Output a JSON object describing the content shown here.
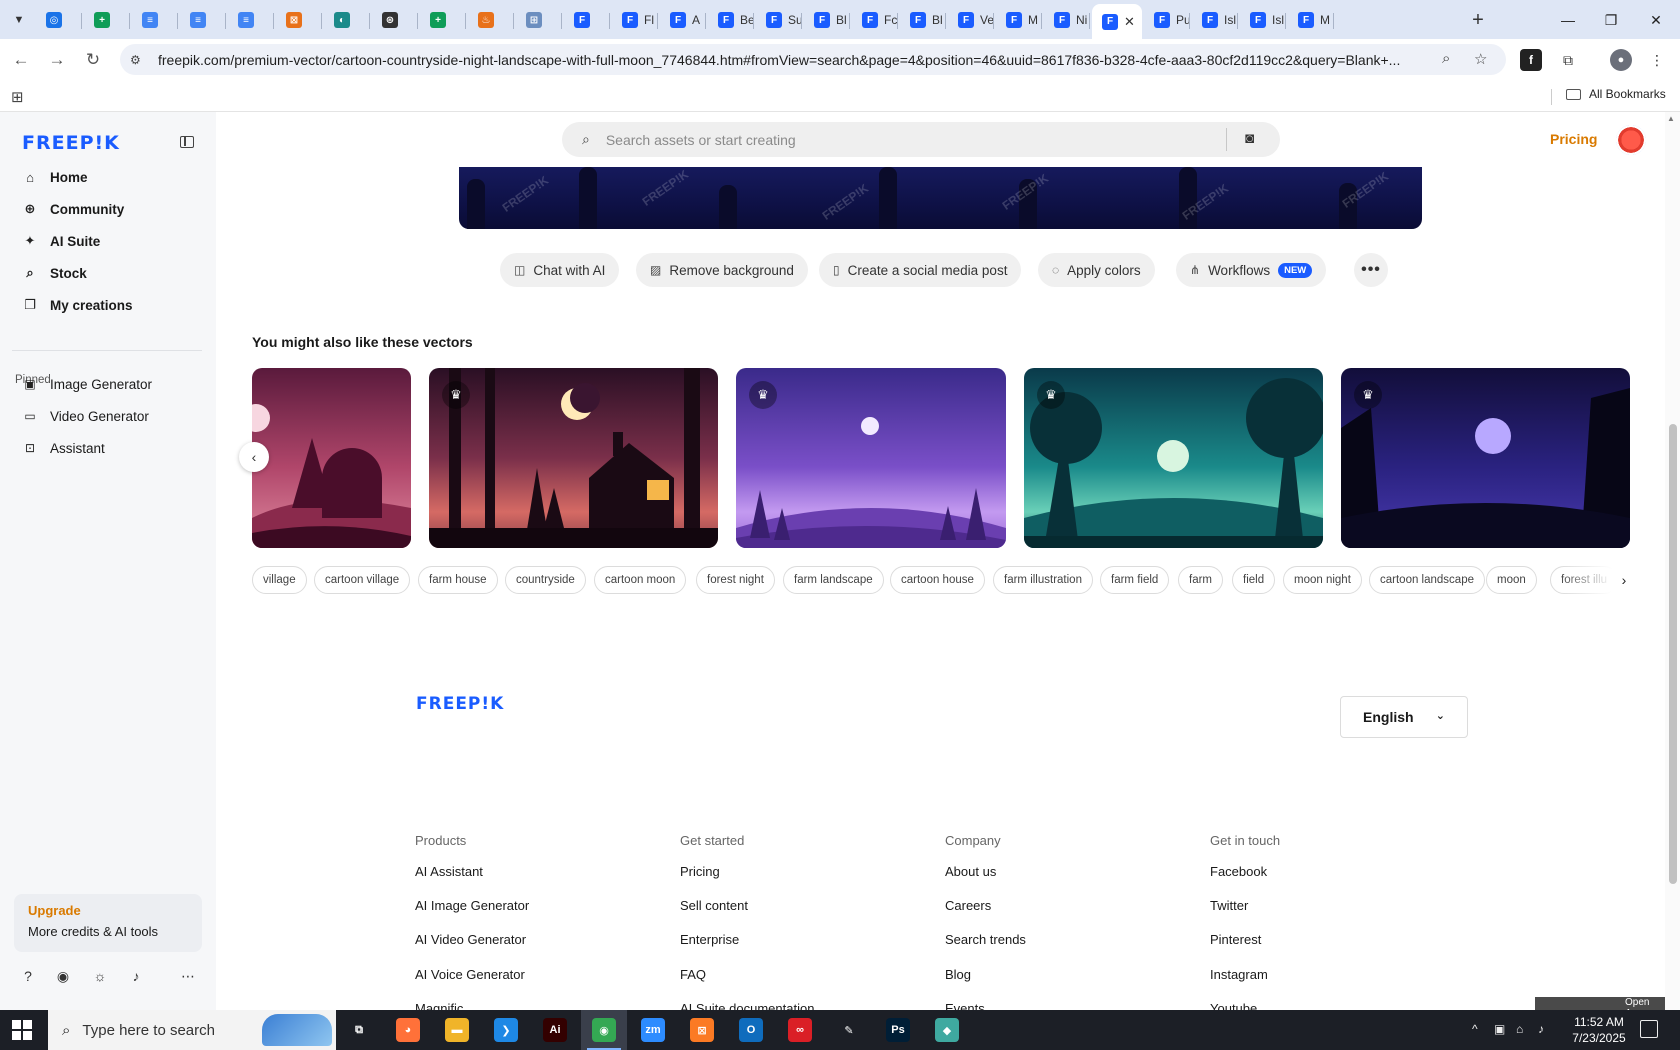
{
  "browser": {
    "tabs": [
      {
        "title": "",
        "color": "#1a73e8",
        "glyph": "◎"
      },
      {
        "title": "",
        "color": "#0f9d58",
        "glyph": "+"
      },
      {
        "title": "",
        "color": "#4285f4",
        "glyph": "≡"
      },
      {
        "title": "",
        "color": "#4285f4",
        "glyph": "≡"
      },
      {
        "title": "",
        "color": "#4285f4",
        "glyph": "≡"
      },
      {
        "title": "",
        "color": "#e8711a",
        "glyph": "⊠"
      },
      {
        "title": "",
        "color": "#1b8a8a",
        "glyph": "◐"
      },
      {
        "title": "",
        "color": "#333333",
        "glyph": "⊛"
      },
      {
        "title": "",
        "color": "#0f9d58",
        "glyph": "+"
      },
      {
        "title": "",
        "color": "#e8711a",
        "glyph": "♨"
      },
      {
        "title": "",
        "color": "#6c8ebf",
        "glyph": "⊞"
      },
      {
        "title": "",
        "color": "#1a5cff",
        "glyph": "F"
      },
      {
        "title": "Fl",
        "color": "#1a5cff",
        "glyph": "F"
      },
      {
        "title": "A",
        "color": "#1a5cff",
        "glyph": "F"
      },
      {
        "title": "Be",
        "color": "#1a5cff",
        "glyph": "F"
      },
      {
        "title": "Su",
        "color": "#1a5cff",
        "glyph": "F"
      },
      {
        "title": "Bl",
        "color": "#1a5cff",
        "glyph": "F"
      },
      {
        "title": "Fc",
        "color": "#1a5cff",
        "glyph": "F"
      },
      {
        "title": "Bl",
        "color": "#1a5cff",
        "glyph": "F"
      },
      {
        "title": "Ve",
        "color": "#1a5cff",
        "glyph": "F"
      },
      {
        "title": "M",
        "color": "#1a5cff",
        "glyph": "F"
      },
      {
        "title": "Ni",
        "color": "#1a5cff",
        "glyph": "F"
      },
      {
        "title": "",
        "color": "#1a5cff",
        "glyph": "F",
        "active": true
      },
      {
        "title": "Pu",
        "color": "#1a5cff",
        "glyph": "F"
      },
      {
        "title": "Isl",
        "color": "#1a5cff",
        "glyph": "F"
      },
      {
        "title": "Isl",
        "color": "#1a5cff",
        "glyph": "F"
      },
      {
        "title": "M",
        "color": "#1a5cff",
        "glyph": "F"
      }
    ],
    "new_tab_glyph": "+",
    "close_tab_glyph": "✕",
    "window_controls": {
      "minimize": "—",
      "restore": "❐",
      "close": "✕"
    },
    "url": "freepik.com/premium-vector/cartoon-countryside-night-landscape-with-full-moon_7746844.htm#fromView=search&page=4&position=46&uuid=8617f836-b328-4cfe-aaa3-80cf2d119cc2&query=Blank+...",
    "all_bookmarks_label": "All Bookmarks"
  },
  "sidebar": {
    "logo": "FREEP!K",
    "nav": [
      {
        "label": "Home",
        "icon": "home-icon",
        "glyph": "⌂"
      },
      {
        "label": "Community",
        "icon": "globe-icon",
        "glyph": "⊕"
      },
      {
        "label": "AI Suite",
        "icon": "sparkle-icon",
        "glyph": "✦"
      },
      {
        "label": "Stock",
        "icon": "search-icon",
        "glyph": "⌕"
      },
      {
        "label": "My creations",
        "icon": "stack-icon",
        "glyph": "❐"
      }
    ],
    "pinned_label": "Pinned",
    "pinned": [
      {
        "label": "Image Generator",
        "icon": "image-icon",
        "glyph": "▣"
      },
      {
        "label": "Video Generator",
        "icon": "video-icon",
        "glyph": "▭"
      },
      {
        "label": "Assistant",
        "icon": "chat-plus-icon",
        "glyph": "⊡"
      }
    ],
    "upgrade": {
      "title": "Upgrade",
      "subtitle": "More credits & AI tools"
    },
    "bottom_icons": [
      {
        "name": "help-icon",
        "glyph": "?"
      },
      {
        "name": "discord-icon",
        "glyph": "◉"
      },
      {
        "name": "theme-icon",
        "glyph": "☼"
      },
      {
        "name": "bell-icon",
        "glyph": "♪"
      },
      {
        "name": "more-icon",
        "glyph": "⋯"
      }
    ]
  },
  "header": {
    "search_placeholder": "Search assets or start creating",
    "pricing_label": "Pricing"
  },
  "actions": [
    {
      "label": "Chat with AI",
      "icon": "chat-icon",
      "glyph": "◫"
    },
    {
      "label": "Remove background",
      "icon": "remove-bg-icon",
      "glyph": "▨"
    },
    {
      "label": "Create a social media post",
      "icon": "phone-icon",
      "glyph": "▯"
    },
    {
      "label": "Apply colors",
      "icon": "palette-icon",
      "glyph": "◌"
    },
    {
      "label": "Workflows",
      "icon": "workflow-icon",
      "glyph": "⋔",
      "badge": "NEW"
    }
  ],
  "more_actions_glyph": "•••",
  "related": {
    "title": "You might also like these vectors",
    "prev_glyph": "‹",
    "crown_glyph": "♛",
    "tags": [
      "village",
      "cartoon village",
      "farm house",
      "countryside",
      "cartoon moon",
      "forest night",
      "farm landscape",
      "cartoon house",
      "farm illustration",
      "farm field",
      "farm",
      "field",
      "moon night",
      "cartoon landscape",
      "moon",
      "forest illu"
    ],
    "next_glyph": "›"
  },
  "footer": {
    "logo": "FREEP!K",
    "language": "English",
    "columns": [
      {
        "title": "Products",
        "links": [
          "AI Assistant",
          "AI Image Generator",
          "AI Video Generator",
          "AI Voice Generator",
          "Magnific"
        ]
      },
      {
        "title": "Get started",
        "links": [
          "Pricing",
          "Sell content",
          "Enterprise",
          "FAQ",
          "AI Suite documentation"
        ]
      },
      {
        "title": "Company",
        "links": [
          "About us",
          "Careers",
          "Search trends",
          "Blog",
          "Events"
        ]
      },
      {
        "title": "Get in touch",
        "links": [
          "Facebook",
          "Twitter",
          "Pinterest",
          "Instagram",
          "Youtube"
        ]
      }
    ],
    "open_app_label": "Open App"
  },
  "taskbar": {
    "search_placeholder": "Type here to search",
    "apps": [
      {
        "name": "task-view-icon",
        "glyph": "⧉",
        "color": "transparent"
      },
      {
        "name": "firefox-icon",
        "glyph": "◕",
        "color": "#ff7139"
      },
      {
        "name": "file-explorer-icon",
        "glyph": "▬",
        "color": "#f0b429"
      },
      {
        "name": "vscode-icon",
        "glyph": "❯",
        "color": "#1e88e5"
      },
      {
        "name": "illustrator-icon",
        "glyph": "Ai",
        "color": "#330000"
      },
      {
        "name": "chrome-icon",
        "glyph": "◉",
        "color": "#34a853",
        "active": true
      },
      {
        "name": "zoom-icon",
        "glyph": "zm",
        "color": "#2d8cff"
      },
      {
        "name": "xampp-icon",
        "glyph": "⊠",
        "color": "#fb7a24"
      },
      {
        "name": "outlook-icon",
        "glyph": "O",
        "color": "#0f6cbd"
      },
      {
        "name": "creative-cloud-icon",
        "glyph": "∞",
        "color": "#da1f26"
      },
      {
        "name": "pen-tool-icon",
        "glyph": "✎",
        "color": "transparent"
      },
      {
        "name": "photoshop-icon",
        "glyph": "Ps",
        "color": "#001e36"
      },
      {
        "name": "app-icon",
        "glyph": "◆",
        "color": "#3fa9a0"
      }
    ],
    "tray_icons": [
      "^",
      "▣",
      "⌂",
      "♪"
    ],
    "time": "11:52 AM",
    "date": "7/23/2025"
  }
}
